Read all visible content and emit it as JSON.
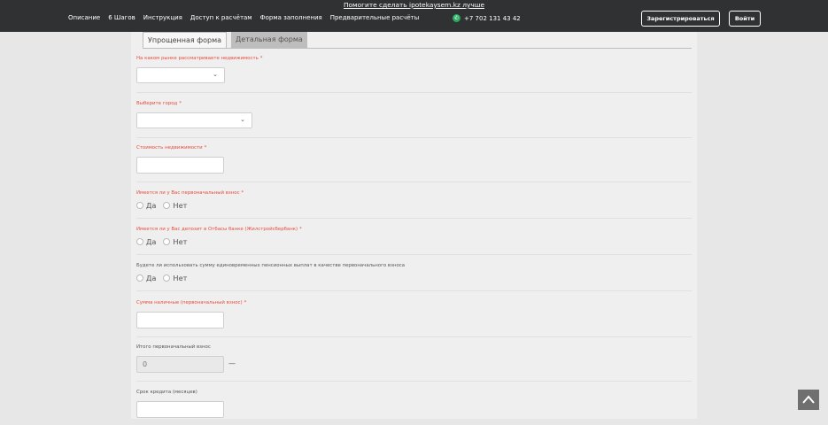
{
  "header": {
    "banner_link": "Помогите сделать ipotekaysem.kz лучше",
    "nav": [
      "Описание",
      "6 Шагов",
      "Инструкция",
      "Доступ к расчётам",
      "Форма заполнения",
      "Предварительные расчёты"
    ],
    "phone": "+7 702 131 43 42",
    "register_label": "Зарегистрироваться",
    "login_label": "Войти"
  },
  "tabs": [
    {
      "label": "Упрощенная форма",
      "active": true
    },
    {
      "label": "Детальная форма",
      "active": false
    }
  ],
  "form": {
    "market_label": "На каком рынке рассматриваете недвижимость",
    "city_label": "Выберите город",
    "price_label": "Стоимость недвижимости",
    "downpayment_q_label": "Имеется ли у Вас первоначальный взнос",
    "deposit_q_label": "Имеется ли у Вас депозит в Отбасы банке (Жилстройсбербанк)",
    "pension_q_label": "Будете ли использовать сумму единовременных пенсионных выплат в качестве первоначального взноса",
    "cash_label": "Сумма наличные (первоначальный взнос)",
    "total_label": "Итого первоначальный взнос",
    "total_value": "0",
    "total_dash": "—",
    "term_label": "Срок кредита (месяцев)",
    "required_mark": "*",
    "yes": "Да",
    "no": "Нет"
  },
  "icons": {
    "phone": "phone-icon",
    "chevron": "chevron-down-icon",
    "scroll_top": "chevron-up-icon"
  },
  "colors": {
    "topbar": "#2f3133",
    "required_label": "#e74c3c",
    "phone_icon": "#27ae60"
  }
}
